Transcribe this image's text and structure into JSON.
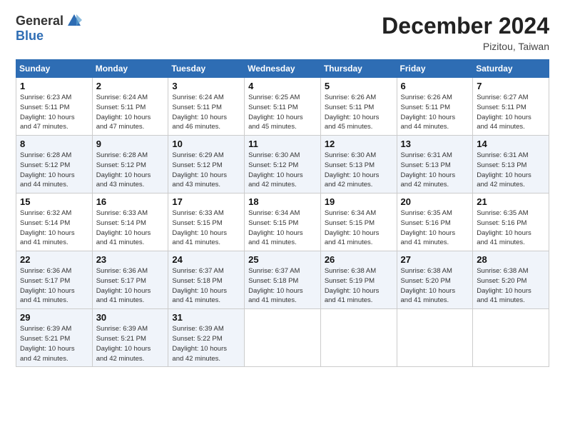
{
  "logo": {
    "general": "General",
    "blue": "Blue"
  },
  "header": {
    "month": "December 2024",
    "location": "Pizitou, Taiwan"
  },
  "weekdays": [
    "Sunday",
    "Monday",
    "Tuesday",
    "Wednesday",
    "Thursday",
    "Friday",
    "Saturday"
  ],
  "weeks": [
    [
      {
        "day": "1",
        "info": "Sunrise: 6:23 AM\nSunset: 5:11 PM\nDaylight: 10 hours\nand 47 minutes."
      },
      {
        "day": "2",
        "info": "Sunrise: 6:24 AM\nSunset: 5:11 PM\nDaylight: 10 hours\nand 47 minutes."
      },
      {
        "day": "3",
        "info": "Sunrise: 6:24 AM\nSunset: 5:11 PM\nDaylight: 10 hours\nand 46 minutes."
      },
      {
        "day": "4",
        "info": "Sunrise: 6:25 AM\nSunset: 5:11 PM\nDaylight: 10 hours\nand 45 minutes."
      },
      {
        "day": "5",
        "info": "Sunrise: 6:26 AM\nSunset: 5:11 PM\nDaylight: 10 hours\nand 45 minutes."
      },
      {
        "day": "6",
        "info": "Sunrise: 6:26 AM\nSunset: 5:11 PM\nDaylight: 10 hours\nand 44 minutes."
      },
      {
        "day": "7",
        "info": "Sunrise: 6:27 AM\nSunset: 5:11 PM\nDaylight: 10 hours\nand 44 minutes."
      }
    ],
    [
      {
        "day": "8",
        "info": "Sunrise: 6:28 AM\nSunset: 5:12 PM\nDaylight: 10 hours\nand 44 minutes."
      },
      {
        "day": "9",
        "info": "Sunrise: 6:28 AM\nSunset: 5:12 PM\nDaylight: 10 hours\nand 43 minutes."
      },
      {
        "day": "10",
        "info": "Sunrise: 6:29 AM\nSunset: 5:12 PM\nDaylight: 10 hours\nand 43 minutes."
      },
      {
        "day": "11",
        "info": "Sunrise: 6:30 AM\nSunset: 5:12 PM\nDaylight: 10 hours\nand 42 minutes."
      },
      {
        "day": "12",
        "info": "Sunrise: 6:30 AM\nSunset: 5:13 PM\nDaylight: 10 hours\nand 42 minutes."
      },
      {
        "day": "13",
        "info": "Sunrise: 6:31 AM\nSunset: 5:13 PM\nDaylight: 10 hours\nand 42 minutes."
      },
      {
        "day": "14",
        "info": "Sunrise: 6:31 AM\nSunset: 5:13 PM\nDaylight: 10 hours\nand 42 minutes."
      }
    ],
    [
      {
        "day": "15",
        "info": "Sunrise: 6:32 AM\nSunset: 5:14 PM\nDaylight: 10 hours\nand 41 minutes."
      },
      {
        "day": "16",
        "info": "Sunrise: 6:33 AM\nSunset: 5:14 PM\nDaylight: 10 hours\nand 41 minutes."
      },
      {
        "day": "17",
        "info": "Sunrise: 6:33 AM\nSunset: 5:15 PM\nDaylight: 10 hours\nand 41 minutes."
      },
      {
        "day": "18",
        "info": "Sunrise: 6:34 AM\nSunset: 5:15 PM\nDaylight: 10 hours\nand 41 minutes."
      },
      {
        "day": "19",
        "info": "Sunrise: 6:34 AM\nSunset: 5:15 PM\nDaylight: 10 hours\nand 41 minutes."
      },
      {
        "day": "20",
        "info": "Sunrise: 6:35 AM\nSunset: 5:16 PM\nDaylight: 10 hours\nand 41 minutes."
      },
      {
        "day": "21",
        "info": "Sunrise: 6:35 AM\nSunset: 5:16 PM\nDaylight: 10 hours\nand 41 minutes."
      }
    ],
    [
      {
        "day": "22",
        "info": "Sunrise: 6:36 AM\nSunset: 5:17 PM\nDaylight: 10 hours\nand 41 minutes."
      },
      {
        "day": "23",
        "info": "Sunrise: 6:36 AM\nSunset: 5:17 PM\nDaylight: 10 hours\nand 41 minutes."
      },
      {
        "day": "24",
        "info": "Sunrise: 6:37 AM\nSunset: 5:18 PM\nDaylight: 10 hours\nand 41 minutes."
      },
      {
        "day": "25",
        "info": "Sunrise: 6:37 AM\nSunset: 5:18 PM\nDaylight: 10 hours\nand 41 minutes."
      },
      {
        "day": "26",
        "info": "Sunrise: 6:38 AM\nSunset: 5:19 PM\nDaylight: 10 hours\nand 41 minutes."
      },
      {
        "day": "27",
        "info": "Sunrise: 6:38 AM\nSunset: 5:20 PM\nDaylight: 10 hours\nand 41 minutes."
      },
      {
        "day": "28",
        "info": "Sunrise: 6:38 AM\nSunset: 5:20 PM\nDaylight: 10 hours\nand 41 minutes."
      }
    ],
    [
      {
        "day": "29",
        "info": "Sunrise: 6:39 AM\nSunset: 5:21 PM\nDaylight: 10 hours\nand 42 minutes."
      },
      {
        "day": "30",
        "info": "Sunrise: 6:39 AM\nSunset: 5:21 PM\nDaylight: 10 hours\nand 42 minutes."
      },
      {
        "day": "31",
        "info": "Sunrise: 6:39 AM\nSunset: 5:22 PM\nDaylight: 10 hours\nand 42 minutes."
      },
      {
        "day": "",
        "info": ""
      },
      {
        "day": "",
        "info": ""
      },
      {
        "day": "",
        "info": ""
      },
      {
        "day": "",
        "info": ""
      }
    ]
  ]
}
